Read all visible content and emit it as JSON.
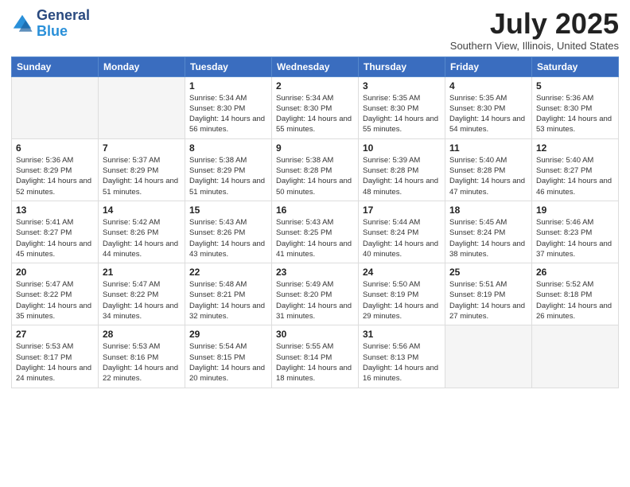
{
  "logo": {
    "general": "General",
    "blue": "Blue"
  },
  "header": {
    "month": "July 2025",
    "location": "Southern View, Illinois, United States"
  },
  "weekdays": [
    "Sunday",
    "Monday",
    "Tuesday",
    "Wednesday",
    "Thursday",
    "Friday",
    "Saturday"
  ],
  "weeks": [
    [
      {
        "day": "",
        "info": ""
      },
      {
        "day": "",
        "info": ""
      },
      {
        "day": "1",
        "info": "Sunrise: 5:34 AM\nSunset: 8:30 PM\nDaylight: 14 hours and 56 minutes."
      },
      {
        "day": "2",
        "info": "Sunrise: 5:34 AM\nSunset: 8:30 PM\nDaylight: 14 hours and 55 minutes."
      },
      {
        "day": "3",
        "info": "Sunrise: 5:35 AM\nSunset: 8:30 PM\nDaylight: 14 hours and 55 minutes."
      },
      {
        "day": "4",
        "info": "Sunrise: 5:35 AM\nSunset: 8:30 PM\nDaylight: 14 hours and 54 minutes."
      },
      {
        "day": "5",
        "info": "Sunrise: 5:36 AM\nSunset: 8:30 PM\nDaylight: 14 hours and 53 minutes."
      }
    ],
    [
      {
        "day": "6",
        "info": "Sunrise: 5:36 AM\nSunset: 8:29 PM\nDaylight: 14 hours and 52 minutes."
      },
      {
        "day": "7",
        "info": "Sunrise: 5:37 AM\nSunset: 8:29 PM\nDaylight: 14 hours and 51 minutes."
      },
      {
        "day": "8",
        "info": "Sunrise: 5:38 AM\nSunset: 8:29 PM\nDaylight: 14 hours and 51 minutes."
      },
      {
        "day": "9",
        "info": "Sunrise: 5:38 AM\nSunset: 8:28 PM\nDaylight: 14 hours and 50 minutes."
      },
      {
        "day": "10",
        "info": "Sunrise: 5:39 AM\nSunset: 8:28 PM\nDaylight: 14 hours and 48 minutes."
      },
      {
        "day": "11",
        "info": "Sunrise: 5:40 AM\nSunset: 8:28 PM\nDaylight: 14 hours and 47 minutes."
      },
      {
        "day": "12",
        "info": "Sunrise: 5:40 AM\nSunset: 8:27 PM\nDaylight: 14 hours and 46 minutes."
      }
    ],
    [
      {
        "day": "13",
        "info": "Sunrise: 5:41 AM\nSunset: 8:27 PM\nDaylight: 14 hours and 45 minutes."
      },
      {
        "day": "14",
        "info": "Sunrise: 5:42 AM\nSunset: 8:26 PM\nDaylight: 14 hours and 44 minutes."
      },
      {
        "day": "15",
        "info": "Sunrise: 5:43 AM\nSunset: 8:26 PM\nDaylight: 14 hours and 43 minutes."
      },
      {
        "day": "16",
        "info": "Sunrise: 5:43 AM\nSunset: 8:25 PM\nDaylight: 14 hours and 41 minutes."
      },
      {
        "day": "17",
        "info": "Sunrise: 5:44 AM\nSunset: 8:24 PM\nDaylight: 14 hours and 40 minutes."
      },
      {
        "day": "18",
        "info": "Sunrise: 5:45 AM\nSunset: 8:24 PM\nDaylight: 14 hours and 38 minutes."
      },
      {
        "day": "19",
        "info": "Sunrise: 5:46 AM\nSunset: 8:23 PM\nDaylight: 14 hours and 37 minutes."
      }
    ],
    [
      {
        "day": "20",
        "info": "Sunrise: 5:47 AM\nSunset: 8:22 PM\nDaylight: 14 hours and 35 minutes."
      },
      {
        "day": "21",
        "info": "Sunrise: 5:47 AM\nSunset: 8:22 PM\nDaylight: 14 hours and 34 minutes."
      },
      {
        "day": "22",
        "info": "Sunrise: 5:48 AM\nSunset: 8:21 PM\nDaylight: 14 hours and 32 minutes."
      },
      {
        "day": "23",
        "info": "Sunrise: 5:49 AM\nSunset: 8:20 PM\nDaylight: 14 hours and 31 minutes."
      },
      {
        "day": "24",
        "info": "Sunrise: 5:50 AM\nSunset: 8:19 PM\nDaylight: 14 hours and 29 minutes."
      },
      {
        "day": "25",
        "info": "Sunrise: 5:51 AM\nSunset: 8:19 PM\nDaylight: 14 hours and 27 minutes."
      },
      {
        "day": "26",
        "info": "Sunrise: 5:52 AM\nSunset: 8:18 PM\nDaylight: 14 hours and 26 minutes."
      }
    ],
    [
      {
        "day": "27",
        "info": "Sunrise: 5:53 AM\nSunset: 8:17 PM\nDaylight: 14 hours and 24 minutes."
      },
      {
        "day": "28",
        "info": "Sunrise: 5:53 AM\nSunset: 8:16 PM\nDaylight: 14 hours and 22 minutes."
      },
      {
        "day": "29",
        "info": "Sunrise: 5:54 AM\nSunset: 8:15 PM\nDaylight: 14 hours and 20 minutes."
      },
      {
        "day": "30",
        "info": "Sunrise: 5:55 AM\nSunset: 8:14 PM\nDaylight: 14 hours and 18 minutes."
      },
      {
        "day": "31",
        "info": "Sunrise: 5:56 AM\nSunset: 8:13 PM\nDaylight: 14 hours and 16 minutes."
      },
      {
        "day": "",
        "info": ""
      },
      {
        "day": "",
        "info": ""
      }
    ]
  ]
}
